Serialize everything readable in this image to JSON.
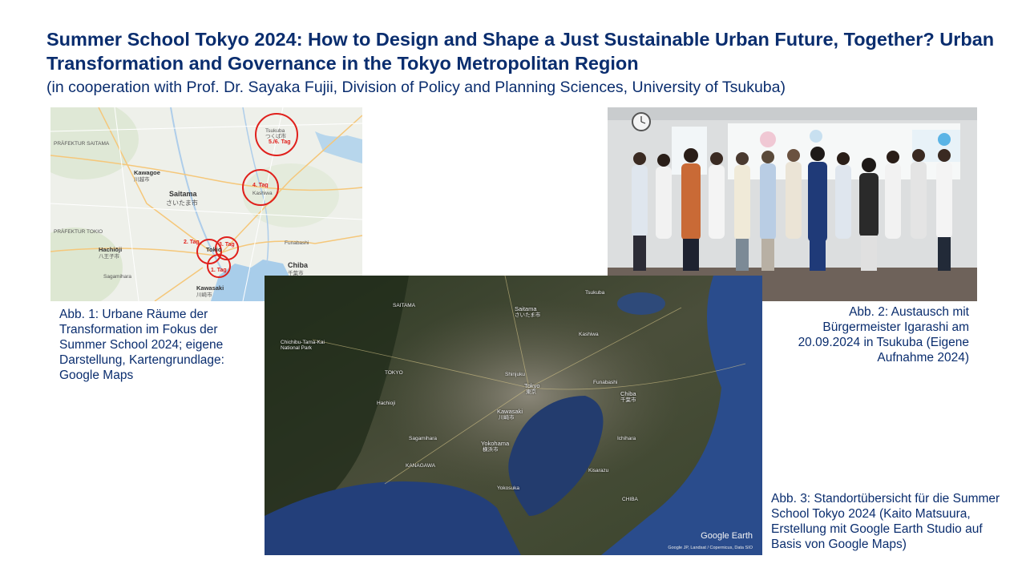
{
  "slide": {
    "title": "Summer School Tokyo 2024: How to Design and Shape a Just Sustainable Urban Future, Together? Urban Transformation and Governance in the Tokyo Metropolitan Region",
    "subtitle": "(in cooperation with Prof. Dr. Sayaka Fujii, Division of Policy and Planning Sciences, University of Tsukuba)"
  },
  "figure1": {
    "caption": "Abb. 1: Urbane Räume der Transformation im Fokus der Summer School 2024; eigene Darstellung, Kartengrundlage: Google Maps",
    "places": {
      "prefektur_saitama": "PRÄFEKTUR SAITAMA",
      "kawagoe": "Kawagoe",
      "kawagoe_jp": "川越市",
      "saitama": "Saitama",
      "saitama_jp": "さいたま市",
      "prefektur_tokio": "PRÄFEKTUR TOKIO",
      "hachioji": "Hachiōji",
      "hachioji_jp": "八王子市",
      "tokio": "Tokio",
      "chiba": "Chiba",
      "chiba_jp": "千葉市",
      "kawasaki": "Kawasaki",
      "kawasaki_jp": "川崎市",
      "tsukuba": "Tsukuba",
      "tsukuba_jp": "つくば市",
      "kashiwa": "Kashiwa",
      "funabashi": "Funabashi",
      "sagamihara": "Sagamihara"
    },
    "markers": {
      "tag56": "5./6. Tag",
      "tag4": "4. Tag",
      "tag2": "2. Tag",
      "tag3": "3. Tag",
      "tag1": "1. Tag"
    }
  },
  "figure2": {
    "caption": "Abb. 2: Austausch mit Bürgermeister Igarashi am 20.09.2024 in Tsukuba (Eigene Aufnahme 2024)"
  },
  "figure3": {
    "caption": "Abb. 3: Standortübersicht für die Summer School Tokyo 2024 (Kaito Matsuura, Erstellung mit Google Earth Studio auf Basis von Google Maps)",
    "logo": "Google Earth",
    "credit": "Google JP, Landsat / Copernicus, Data SIO",
    "places": {
      "saitama": "SAITAMA",
      "saitama_city": "Saitama",
      "saitama_jp": "さいたま市",
      "tokyo": "Tokyo",
      "tokyo_jp": "東京",
      "tokyo_pref": "TOKYO",
      "chiba": "Chiba",
      "chiba_jp": "千葉市",
      "chiba_pref": "CHIBA",
      "kawasaki": "Kawasaki",
      "kawasaki_jp": "川崎市",
      "yokohama": "Yokohama",
      "yokohama_jp": "横浜市",
      "kanagawa": "KANAGAWA",
      "funabashi": "Funabashi",
      "shinjuku": "Shinjuku",
      "kashiwa": "Kashiwa",
      "tsukuba": "Tsukuba",
      "chichibu": "Chichibu-Tama-Kai National Park",
      "hachioji": "Hachioji",
      "sagamihara": "Sagamihara",
      "yokosuka": "Yokosuka",
      "ichihara": "Ichihara",
      "kisarazu": "Kisarazu"
    }
  }
}
